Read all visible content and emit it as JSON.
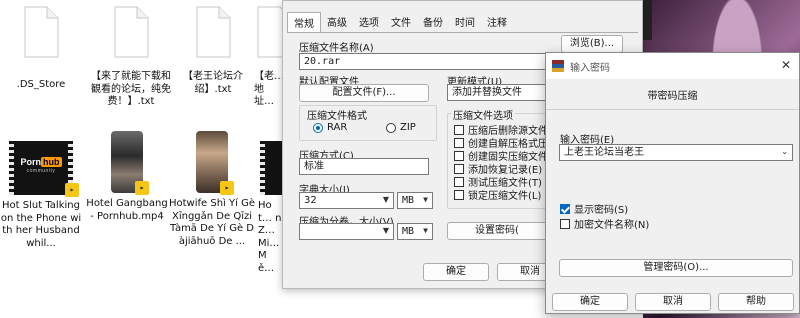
{
  "explorer": {
    "files": [
      {
        "name": ".DS_Store",
        "kind": "document"
      },
      {
        "name": "【来了就能下载和観看的论坛，纯免费！】.txt",
        "kind": "document"
      },
      {
        "name": "【老王论坛介绍】.txt",
        "kind": "document"
      },
      {
        "name": "【老…地址…",
        "kind": "document"
      },
      {
        "name": "Hot Slut Talking on the Phone with her Husband whil...",
        "kind": "video"
      },
      {
        "name": "Hotel Gangbang - Pornhub.mp4",
        "kind": "video"
      },
      {
        "name": "Hotwife Shì Yí Gè Xīnggǎn De Qīzi Tàmā De Yí Gè Dàjiāhuō De ...",
        "kind": "video"
      },
      {
        "name": "Hot… n Z… Mi… Mě…",
        "kind": "video"
      }
    ],
    "thumb_logo": {
      "porn": "Porn",
      "hub": "hub",
      "community": "community"
    }
  },
  "archive_window": {
    "tabs": [
      "常规",
      "高级",
      "选项",
      "文件",
      "备份",
      "时间",
      "注释"
    ],
    "active_tab": "常规",
    "archive_name_label": "压缩文件名称(A)",
    "archive_name_value": "20.rar",
    "browse_button": "浏览(B)...",
    "default_profile_label": "默认配置文件",
    "profile_button": "配置文件(F)...",
    "update_mode_label": "更新模式(U)",
    "update_mode_value": "添加并替换文件",
    "format_group_label": "压缩文件格式",
    "format_options": [
      "RAR",
      "ZIP"
    ],
    "format_selected": "RAR",
    "method_label": "压缩方式(C)",
    "method_value": "标准",
    "dict_label": "字典大小(I)",
    "dict_value": "32",
    "dict_unit": "MB",
    "split_label": "压缩为分卷，大小(V)",
    "split_value": "",
    "split_unit": "MB",
    "options_group_label": "压缩文件选项",
    "options": [
      "压缩后删除源文件",
      "创建自解压格式压",
      "创建固实压缩文件",
      "添加恢复记录(E)",
      "测试压缩文件(T)",
      "锁定压缩文件(L)"
    ],
    "set_password_button": "设置密码(",
    "ok_button": "确定",
    "cancel_button": "取消"
  },
  "password_dialog": {
    "title": "输入密码",
    "heading": "带密码压缩",
    "enter_label": "输入密码(E)",
    "password_value": "上老王论坛当老王",
    "show_password_label": "显示密码(S)",
    "show_password_checked": true,
    "encrypt_names_label": "加密文件名称(N)",
    "encrypt_names_checked": false,
    "manage_button": "管理密码(O)...",
    "ok_button": "确定",
    "cancel_button": "取消",
    "help_button": "帮助"
  },
  "colors": {
    "accent": "#0067c0",
    "dialog_bg": "#f0f0f0",
    "phub_orange": "#ff9900"
  }
}
